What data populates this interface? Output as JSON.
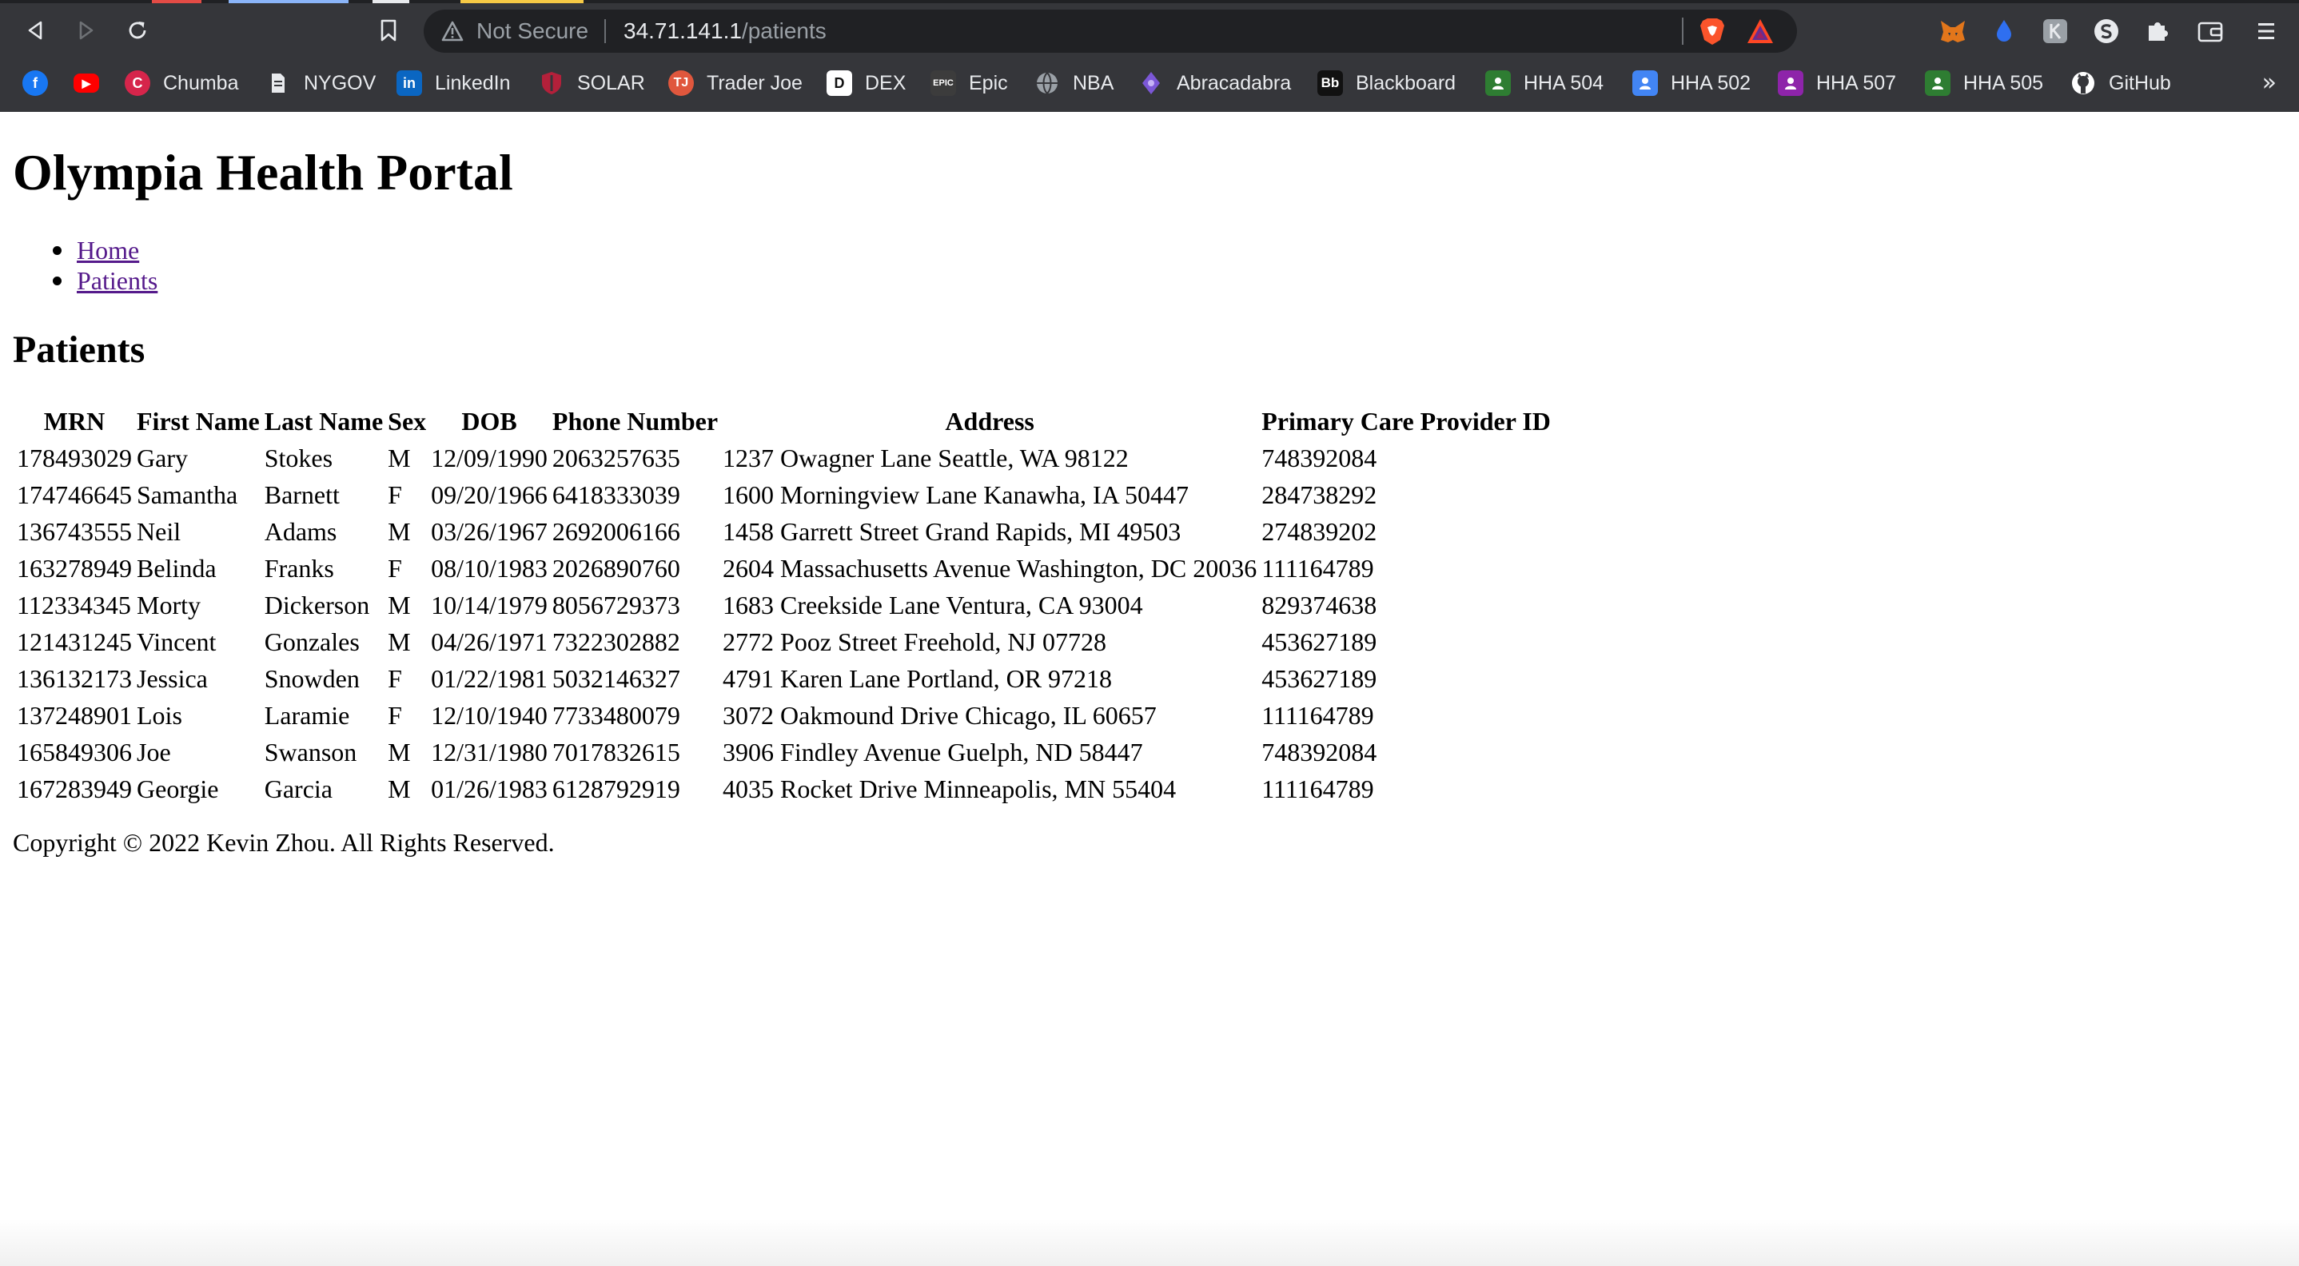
{
  "browser": {
    "security_label": "Not Secure",
    "url_host": "34.71.141.1",
    "url_path": "/patients",
    "bookmarks": [
      {
        "label": "",
        "icon": "facebook-icon",
        "color": "#1877f2"
      },
      {
        "label": "",
        "icon": "youtube-icon",
        "color": "#ff0000"
      },
      {
        "label": "Chumba",
        "icon": "chumba-icon",
        "color": "#d6254b"
      },
      {
        "label": "NYGOV",
        "icon": "document-icon",
        "color": "#9aa0a6"
      },
      {
        "label": "LinkedIn",
        "icon": "linkedin-icon",
        "color": "#0a66c2"
      },
      {
        "label": "SOLAR",
        "icon": "shield-icon",
        "color": "#b3203a"
      },
      {
        "label": "Trader Joe",
        "icon": "trader-joe-icon",
        "color": "#e0573d"
      },
      {
        "label": "DEX",
        "icon": "dex-icon",
        "color": "#ffffff"
      },
      {
        "label": "Epic",
        "icon": "epic-icon",
        "color": "#3c3c3c"
      },
      {
        "label": "NBA",
        "icon": "globe-icon",
        "color": "#9aa0a6"
      },
      {
        "label": "Abracadabra",
        "icon": "abracadabra-icon",
        "color": "#7b57d6"
      },
      {
        "label": "Blackboard",
        "icon": "blackboard-icon",
        "color": "#111111"
      },
      {
        "label": "HHA 504",
        "icon": "classroom-icon",
        "color": "#2e7d32"
      },
      {
        "label": "HHA 502",
        "icon": "classroom-icon",
        "color": "#4285f4"
      },
      {
        "label": "HHA 507",
        "icon": "classroom-icon",
        "color": "#8e24aa"
      },
      {
        "label": "HHA 505",
        "icon": "classroom-icon",
        "color": "#2e7d32"
      },
      {
        "label": "GitHub",
        "icon": "github-icon",
        "color": "#ffffff"
      }
    ],
    "more_label": "»"
  },
  "page": {
    "title": "Olympia Health Portal",
    "nav": [
      {
        "label": "Home"
      },
      {
        "label": "Patients"
      }
    ],
    "section_title": "Patients",
    "table": {
      "headers": [
        "MRN",
        "First Name",
        "Last Name",
        "Sex",
        "DOB",
        "Phone Number",
        "Address",
        "Primary Care Provider ID"
      ],
      "rows": [
        [
          "178493029",
          "Gary",
          "Stokes",
          "M",
          "12/09/1990",
          "2063257635",
          "1237 Owagner Lane Seattle, WA 98122",
          "748392084"
        ],
        [
          "174746645",
          "Samantha",
          "Barnett",
          "F",
          "09/20/1966",
          "6418333039",
          "1600 Morningview Lane Kanawha, IA 50447",
          "284738292"
        ],
        [
          "136743555",
          "Neil",
          "Adams",
          "M",
          "03/26/1967",
          "2692006166",
          "1458 Garrett Street Grand Rapids, MI 49503",
          "274839202"
        ],
        [
          "163278949",
          "Belinda",
          "Franks",
          "F",
          "08/10/1983",
          "2026890760",
          "2604 Massachusetts Avenue Washington, DC 20036",
          "111164789"
        ],
        [
          "112334345",
          "Morty",
          "Dickerson",
          "M",
          "10/14/1979",
          "8056729373",
          "1683 Creekside Lane Ventura, CA 93004",
          "829374638"
        ],
        [
          "121431245",
          "Vincent",
          "Gonzales",
          "M",
          "04/26/1971",
          "7322302882",
          "2772 Pooz Street Freehold, NJ 07728",
          "453627189"
        ],
        [
          "136132173",
          "Jessica",
          "Snowden",
          "F",
          "01/22/1981",
          "5032146327",
          "4791 Karen Lane Portland, OR 97218",
          "453627189"
        ],
        [
          "137248901",
          "Lois",
          "Laramie",
          "F",
          "12/10/1940",
          "7733480079",
          "3072 Oakmound Drive Chicago, IL 60657",
          "111164789"
        ],
        [
          "165849306",
          "Joe",
          "Swanson",
          "M",
          "12/31/1980",
          "7017832615",
          "3906 Findley Avenue Guelph, ND 58447",
          "748392084"
        ],
        [
          "167283949",
          "Georgie",
          "Garcia",
          "M",
          "01/26/1983",
          "6128792919",
          "4035 Rocket Drive Minneapolis, MN 55404",
          "111164789"
        ]
      ]
    },
    "footer": "Copyright © 2022 Kevin Zhou. All Rights Reserved."
  }
}
